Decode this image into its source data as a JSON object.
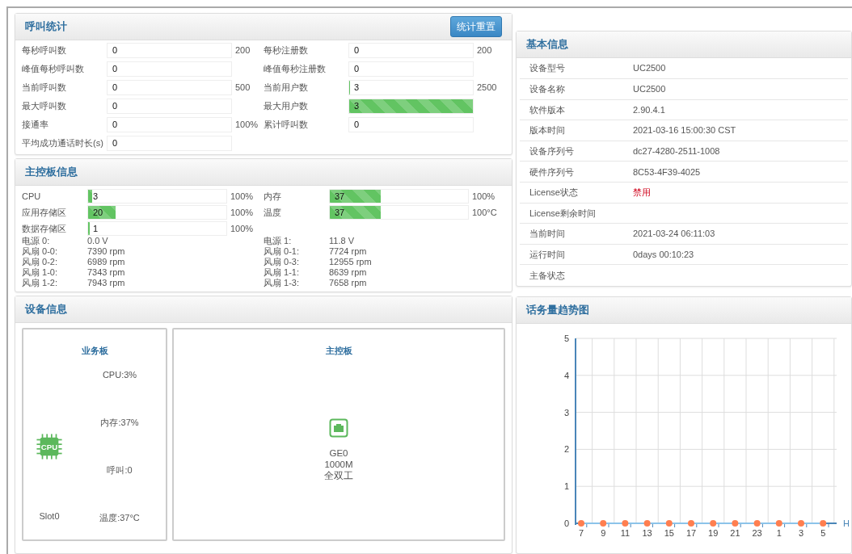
{
  "call_stats": {
    "title": "呼叫统计",
    "reset_button": "统计重置",
    "items": [
      {
        "label": "每秒呼叫数",
        "value": "0",
        "level": 0,
        "max": "200"
      },
      {
        "label": "每秒注册数",
        "value": "0",
        "level": 0,
        "max": "200"
      },
      {
        "label": "峰值每秒呼叫数",
        "value": "0",
        "level": 0
      },
      {
        "label": "峰值每秒注册数",
        "value": "0",
        "level": 0
      },
      {
        "label": "当前呼叫数",
        "value": "0",
        "level": 0,
        "max": "500"
      },
      {
        "label": "当前用户数",
        "value": "3",
        "level": 0.005,
        "max": "2500"
      },
      {
        "label": "最大呼叫数",
        "value": "0",
        "level": 0
      },
      {
        "label": "最大用户数",
        "value": "3",
        "level": 1
      },
      {
        "label": "接通率",
        "value": "0",
        "level": 0,
        "max": "100%"
      },
      {
        "label": "累计呼叫数",
        "value": "0",
        "level": 0
      },
      {
        "label": "平均成功通话时长(s)",
        "value": "0",
        "level": 0
      }
    ]
  },
  "main_board": {
    "title": "主控板信息",
    "meters": [
      {
        "label": "CPU",
        "value": "3",
        "level": 0.03,
        "max": "100%"
      },
      {
        "label": "内存",
        "value": "37",
        "level": 0.37,
        "max": "100%"
      },
      {
        "label": "应用存储区",
        "value": "20",
        "level": 0.2,
        "max": "100%"
      },
      {
        "label": "温度",
        "value": "37",
        "level": 0.37,
        "max": "100°C"
      },
      {
        "label": "数据存储区",
        "value": "1",
        "level": 0.01,
        "max": "100%"
      }
    ],
    "readings": [
      {
        "label": "电源 0:",
        "value": "0.0 V"
      },
      {
        "label": "电源 1:",
        "value": "11.8 V"
      },
      {
        "label": "风扇 0-0:",
        "value": "7390 rpm"
      },
      {
        "label": "风扇 0-1:",
        "value": "7724 rpm"
      },
      {
        "label": "风扇 0-2:",
        "value": "6989 rpm"
      },
      {
        "label": "风扇 0-3:",
        "value": "12955 rpm"
      },
      {
        "label": "风扇 1-0:",
        "value": "7343 rpm"
      },
      {
        "label": "风扇 1-1:",
        "value": "8639 rpm"
      },
      {
        "label": "风扇 1-2:",
        "value": "7943 rpm"
      },
      {
        "label": "风扇 1-3:",
        "value": "7658 rpm"
      }
    ]
  },
  "device_info": {
    "title": "设备信息",
    "service_board": {
      "title": "业务板",
      "icon_label": "CPU",
      "slot": "Slot0",
      "stats": [
        "CPU:3%",
        "内存:37%",
        "呼叫:0",
        "温度:37°C"
      ]
    },
    "control_board": {
      "title": "主控板",
      "port": [
        "GE0",
        "1000M",
        "全双工"
      ]
    }
  },
  "basic_info": {
    "title": "基本信息",
    "rows": [
      {
        "label": "设备型号",
        "value": "UC2500",
        "alert": false
      },
      {
        "label": "设备名称",
        "value": "UC2500",
        "alert": false
      },
      {
        "label": "软件版本",
        "value": "2.90.4.1",
        "alert": false
      },
      {
        "label": "版本时间",
        "value": "2021-03-16 15:00:30 CST",
        "alert": false
      },
      {
        "label": "设备序列号",
        "value": "dc27-4280-2511-1008",
        "alert": false
      },
      {
        "label": "硬件序列号",
        "value": "8C53-4F39-4025",
        "alert": false
      },
      {
        "label": "License状态",
        "value": "禁用",
        "alert": true
      },
      {
        "label": "License剩余时间",
        "alert": false
      },
      {
        "label": "当前时间",
        "value": "2021-03-24 06:11:03",
        "alert": false
      },
      {
        "label": "运行时间",
        "value": "0days 00:10:23",
        "alert": false
      },
      {
        "label": "主备状态",
        "alert": false
      }
    ]
  },
  "traffic": {
    "title": "话务量趋势图",
    "chart_data": {
      "type": "line",
      "xlabel": "H",
      "categories": [
        "7",
        "9",
        "11",
        "13",
        "15",
        "17",
        "19",
        "21",
        "23",
        "1",
        "3",
        "5"
      ],
      "grid": true,
      "series": [
        {
          "color": "#ff7f50",
          "marker": "circle",
          "values": [
            0,
            0,
            0,
            0,
            0,
            0,
            0,
            0,
            0,
            0,
            0,
            0
          ]
        }
      ],
      "ylim": [
        0,
        5
      ],
      "yticks": [
        0,
        1,
        2,
        3,
        4,
        5
      ]
    }
  }
}
